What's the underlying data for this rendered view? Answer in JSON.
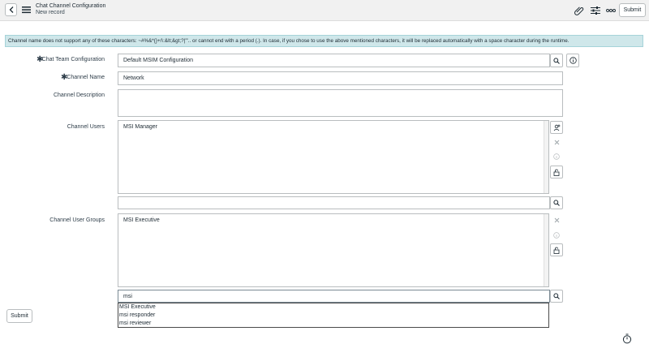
{
  "header": {
    "title": "Chat Channel Configuration",
    "subtitle": "New record",
    "submit_label": "Submit",
    "icons": [
      "back-icon",
      "menu-icon",
      "paperclip-icon",
      "settings-sliders-icon",
      "more-options-icon"
    ]
  },
  "banner": {
    "text": "Channel name does not support any of these characters: ~#%&*{}+/\\:&lt;&gt;?|\"'.. or cannot end with a period (.). In case, if you chose to use the above mentioned characters, it will be replaced automatically with a space character during the runtime."
  },
  "form": {
    "chat_team_configuration": {
      "label": "Chat Team Configuration",
      "value": "Default MSIM Configuration"
    },
    "channel_name": {
      "label": "Channel Name",
      "value": "Network"
    },
    "channel_description": {
      "label": "Channel Description",
      "value": ""
    },
    "channel_users": {
      "label": "Channel Users",
      "items": [
        "MSI Manager"
      ],
      "search_value": ""
    },
    "channel_user_groups": {
      "label": "Channel User Groups",
      "items": [
        "MSI Executive"
      ],
      "search_value": "msi",
      "dropdown_options": [
        "MSI Executive",
        "msi responder",
        "msi reviewer"
      ]
    }
  },
  "footer": {
    "submit_label": "Submit"
  },
  "colors": {
    "banner_bg": "#cfe7ea",
    "header_bg": "#f1f1f1"
  }
}
